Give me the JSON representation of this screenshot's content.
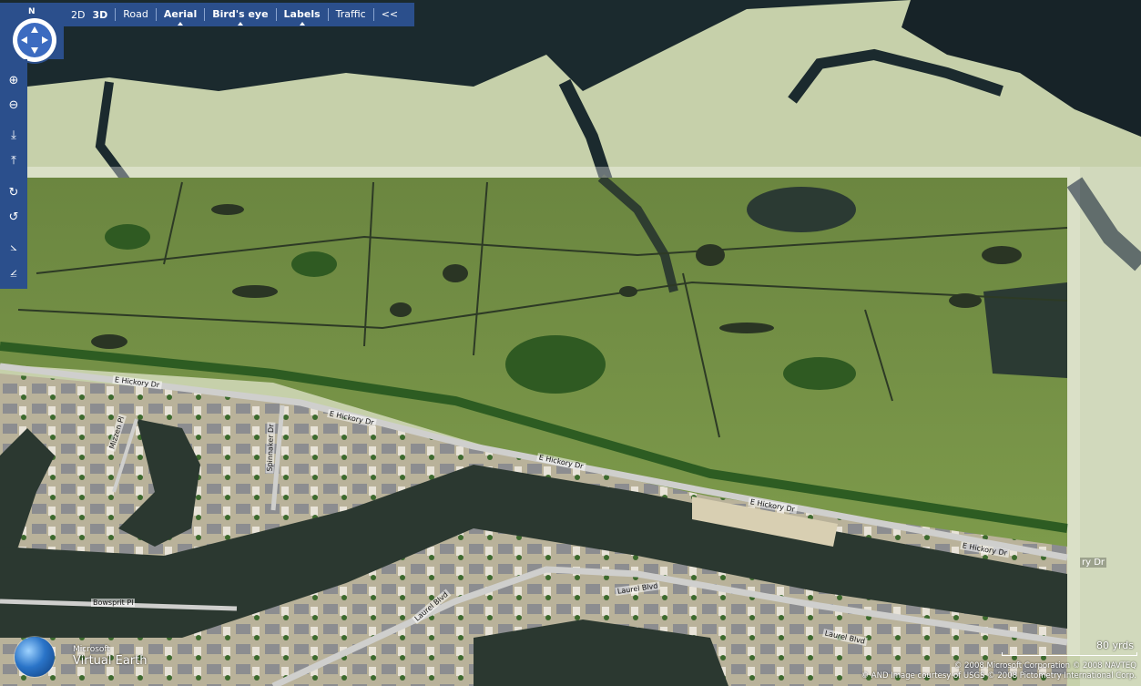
{
  "toolbar": {
    "mode_2d": "2D",
    "mode_3d": "3D",
    "road": "Road",
    "aerial": "Aerial",
    "birds_eye": "Bird's eye",
    "labels": "Labels",
    "traffic": "Traffic",
    "collapse": "<<"
  },
  "compass": {
    "north": "N"
  },
  "road_labels": {
    "e_hickory_1": "E Hickory Dr",
    "e_hickory_2": "E Hickory Dr",
    "e_hickory_3": "E Hickory Dr",
    "e_hickory_4": "E Hickory Dr",
    "e_hickory_5": "E Hickory Dr",
    "hickory_partial": "ry Dr",
    "bowsprit": "Bowsprit Pl",
    "laurel_1": "Laurel Blvd",
    "laurel_2": "Laurel Blvd",
    "laurel_3": "Laurel Blvd",
    "spinnaker": "Spinnaker Dr",
    "mizzen": "Mizzen Pl"
  },
  "branding": {
    "microsoft": "Microsoft",
    "virtual_earth": "Virtual Earth"
  },
  "scale": {
    "label": "80 yrds"
  },
  "copyright": {
    "line1": "© 2008 Microsoft Corporation  © 2008 NAVTEQ",
    "line2": "© AND  Image courtesy of USGS © 2008 Pictometry International Corp."
  },
  "colors": {
    "toolbar_bg": "#2b4f8c",
    "water": "#1e2f33",
    "marsh": "#5e7a3a",
    "marsh_faded": "#c9d3ac"
  }
}
